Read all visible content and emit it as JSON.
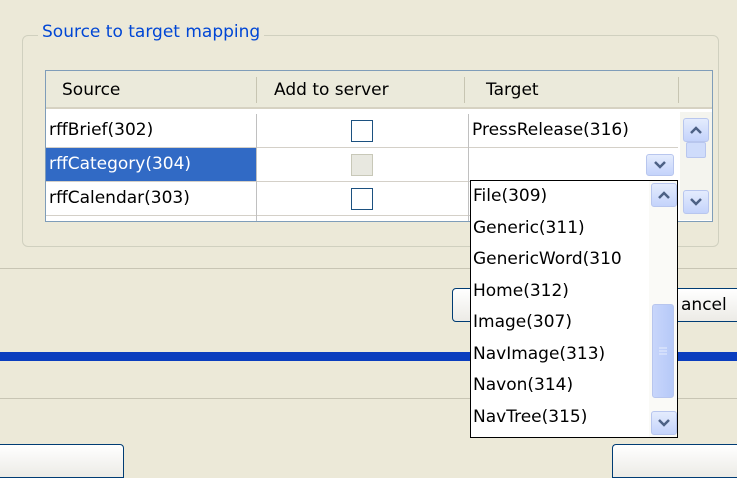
{
  "group_title": "Source to target mapping",
  "columns": [
    "Source",
    "Add to server",
    "Target"
  ],
  "rows": [
    {
      "source": "rffBrief(302)",
      "add_to_server": false,
      "target": "PressRelease(316)"
    },
    {
      "source": "rffCategory(304)",
      "add_to_server": false,
      "target": ""
    },
    {
      "source": "rffCalendar(303)",
      "add_to_server": false,
      "target": ""
    }
  ],
  "selected_row": 1,
  "dropdown_options": [
    "File(309)",
    "Generic(311)",
    "GenericWord(310",
    "Home(312)",
    "Image(307)",
    "NavImage(313)",
    "Navon(314)",
    "NavTree(315)"
  ],
  "cancel_button_partial": "ancel",
  "colors": {
    "selection": "#316AC5",
    "title": "#0046D5",
    "blue_bar": "#0A3DBE"
  }
}
